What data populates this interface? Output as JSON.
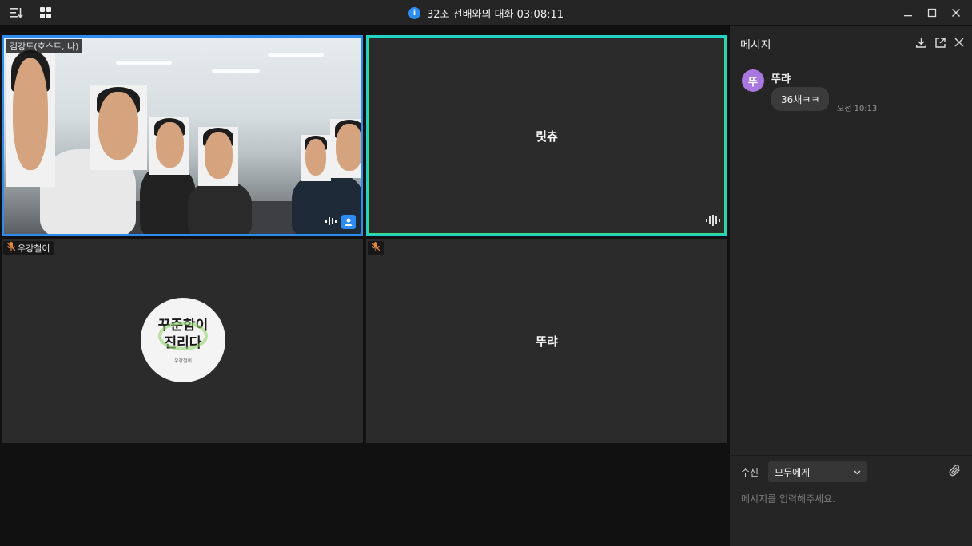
{
  "titlebar": {
    "info_icon_glyph": "i",
    "meeting_title": "32조 선배와의 대화 03:08:11"
  },
  "tiles": {
    "tile1": {
      "label": "김강도(호스트, 나)"
    },
    "tile2": {
      "name": "릿츄"
    },
    "tile3": {
      "label": "우강철이",
      "avatar_line1": "꾸준함이",
      "avatar_line2": "진리다",
      "avatar_small": "우강철이"
    },
    "tile4": {
      "name": "뚜랴"
    }
  },
  "chat": {
    "title": "메시지",
    "messages": [
      {
        "avatar": "뚜",
        "sender": "뚜랴",
        "text": "36채ㅋㅋ",
        "time": "오전 10:13"
      }
    ],
    "recipient_label": "수신",
    "recipient_value": "모두에게",
    "input_placeholder": "메시지를 입력해주세요."
  },
  "colors": {
    "active_speaker_border": "#2d8cf0",
    "speaking_border": "#22d3c5",
    "avatar_bg": "#a878e0"
  },
  "icons": [
    "sort-icon",
    "grid-view-icon",
    "info-icon",
    "minimize-icon",
    "maximize-icon",
    "close-icon",
    "download-icon",
    "popout-icon",
    "close-chat-icon",
    "mic-muted-icon",
    "audio-level-icon",
    "user-icon",
    "chevron-down-icon",
    "attachment-icon"
  ]
}
